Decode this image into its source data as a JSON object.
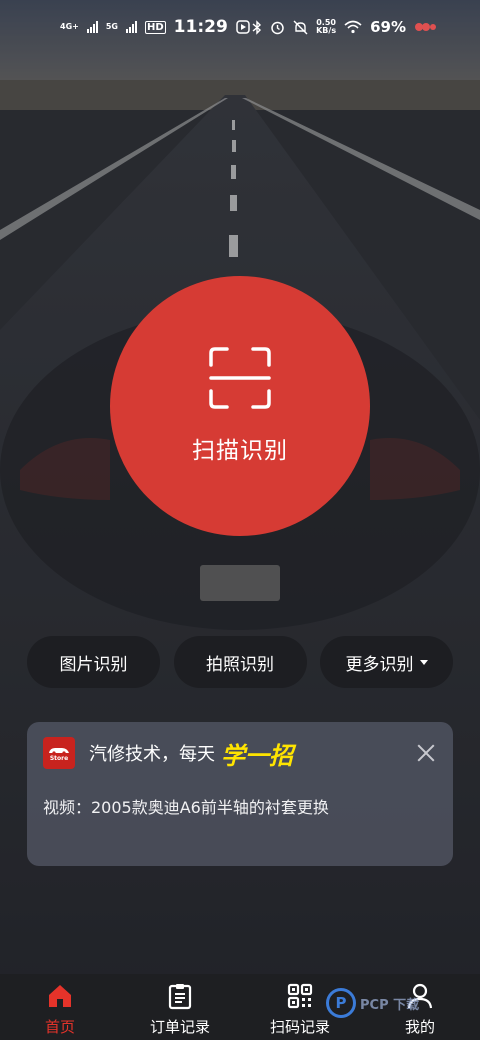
{
  "status_bar": {
    "net1": "4G+",
    "net2": "5G",
    "hd": "HD",
    "time": "11:29",
    "speed_value": "0.50",
    "speed_unit": "KB/s",
    "battery": "69%"
  },
  "scan": {
    "label": "扫描识别",
    "color": "#d63b34"
  },
  "actions": [
    {
      "label": "图片识别"
    },
    {
      "label": "拍照识别"
    },
    {
      "label": "更多识别"
    }
  ],
  "notice": {
    "logo_text_top": "汽修",
    "logo_text_bottom": "Store",
    "title": "汽修技术，每天",
    "highlight": "学一招",
    "body": "视频：2005款奥迪A6前半轴的衬套更换"
  },
  "tabbar": {
    "active_color": "#e5332a",
    "items": [
      {
        "label": "首页",
        "icon": "home-icon"
      },
      {
        "label": "订单记录",
        "icon": "clipboard-icon"
      },
      {
        "label": "扫码记录",
        "icon": "qr-code-icon"
      },
      {
        "label": "我的",
        "icon": "user-icon"
      }
    ]
  },
  "watermark": {
    "text": "PCP  下载"
  }
}
